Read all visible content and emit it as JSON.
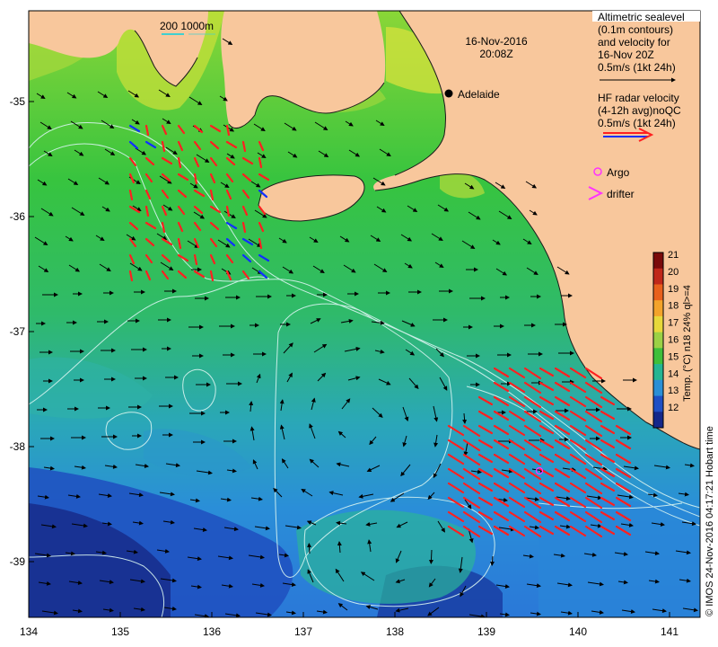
{
  "map": {
    "date_line": "16-Nov-2016",
    "time_line": "20:08Z",
    "scale_label": "200 1000m",
    "city": "Adelaide",
    "legend": {
      "altimetry_lines": [
        "Altimetric sealevel",
        "(0.1m contours)",
        "and velocity for",
        "16-Nov 20Z",
        "0.5m/s (1kt 24h)"
      ],
      "radar_lines": [
        "HF radar velocity",
        "(4-12h avg)noQC",
        "0.5m/s (1kt 24h)"
      ],
      "argo_label": "Argo",
      "drifter_label": "drifter"
    },
    "colorbar": {
      "title": "Temp. (°C) n18 24% ql>=4",
      "ticks": [
        "21",
        "20",
        "19",
        "18",
        "17",
        "16",
        "15",
        "14",
        "13",
        "12"
      ],
      "colors": [
        "#7a0b0b",
        "#c0281a",
        "#e8601c",
        "#f3a32a",
        "#e7d83a",
        "#9bd145",
        "#3fbf3a",
        "#25b592",
        "#2b8fd6",
        "#1f4fc4",
        "#14288a"
      ]
    },
    "credit": "© IMOS 24-Nov-2016 04:17:21 Hobart time",
    "x_ticks": [
      "134",
      "135",
      "136",
      "137",
      "138",
      "139",
      "140",
      "141"
    ],
    "y_ticks": [
      "-35",
      "-36",
      "-37",
      "-38",
      "-39"
    ],
    "colors": {
      "land": "#f8c79c",
      "hf_radar": "#ff2020",
      "hf_radar_blue": "#1030ff",
      "argo": "#ff33ff",
      "contour": "#d8f4f0"
    }
  }
}
